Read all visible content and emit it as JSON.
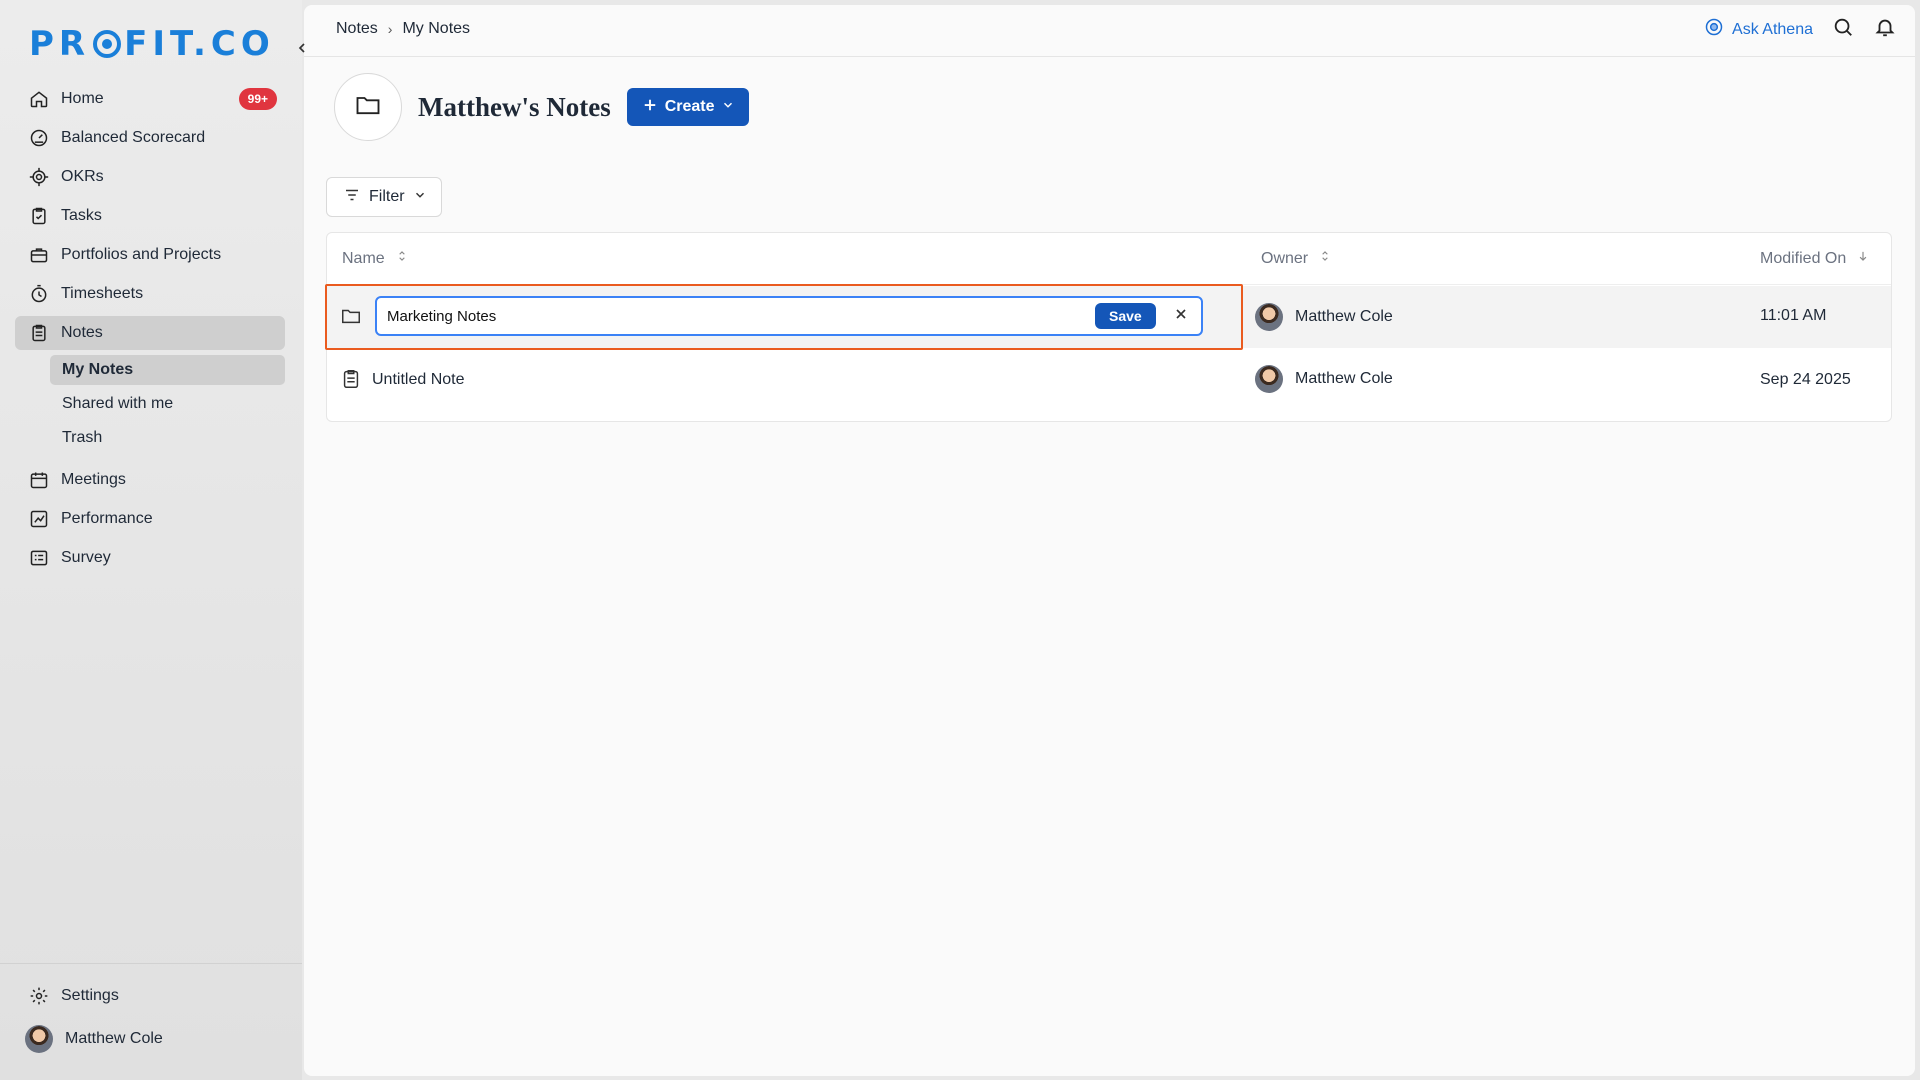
{
  "brand": {
    "logo_text_left": "PR",
    "logo_text_right": "FIT.CO"
  },
  "sidebar": {
    "items": [
      {
        "label": "Home",
        "badge": "99+",
        "icon": "home-icon"
      },
      {
        "label": "Balanced Scorecard",
        "icon": "scorecard-icon"
      },
      {
        "label": "OKRs",
        "icon": "target-icon"
      },
      {
        "label": "Tasks",
        "icon": "clipboard-icon"
      },
      {
        "label": "Portfolios and Projects",
        "icon": "briefcase-icon"
      },
      {
        "label": "Timesheets",
        "icon": "stopwatch-icon"
      },
      {
        "label": "Notes",
        "icon": "notes-icon"
      },
      {
        "label": "Meetings",
        "icon": "calendar-icon"
      },
      {
        "label": "Performance",
        "icon": "chart-icon"
      },
      {
        "label": "Survey",
        "icon": "survey-icon"
      }
    ],
    "notes_sub": [
      "My Notes",
      "Shared with me",
      "Trash"
    ],
    "settings_label": "Settings",
    "user_name": "Matthew Cole"
  },
  "topbar": {
    "breadcrumb": [
      "Notes",
      "My Notes"
    ],
    "breadcrumb_sep": "›",
    "ask_athena": "Ask Athena"
  },
  "page": {
    "title": "Matthew's Notes",
    "create_label": "Create",
    "filter_label": "Filter"
  },
  "table": {
    "columns": [
      "Name",
      "Owner",
      "Modified On"
    ],
    "rows": [
      {
        "name_input_value": "Marketing Notes",
        "save_label": "Save",
        "owner": "Matthew Cole",
        "modified": "11:01 AM"
      },
      {
        "name": "Untitled Note",
        "owner": "Matthew Cole",
        "modified": "Sep 24 2025"
      }
    ]
  },
  "colors": {
    "brand": "#1a7fd9",
    "primary": "#1456b8",
    "badge": "#e0353f",
    "highlight": "#ea5b1f"
  }
}
